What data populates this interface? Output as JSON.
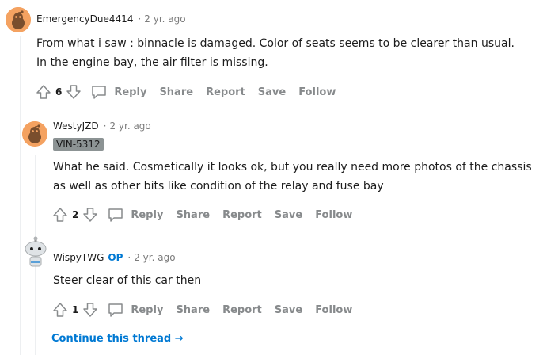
{
  "actions": {
    "reply": "Reply",
    "share": "Share",
    "report": "Report",
    "save": "Save",
    "follow": "Follow"
  },
  "comments": [
    {
      "username": "EmergencyDue4414",
      "separator": "·",
      "time": "2 yr. ago",
      "text": "From what i saw : binnacle is damaged. Color of seats seems to be clearer than usual. In the engine bay, the air filter is missing.",
      "votes": "6",
      "avatar_icon": "snoo-avatar-icon"
    },
    {
      "username": "WestyJZD",
      "separator": "·",
      "time": "2 yr. ago",
      "flair": "VIN-5312",
      "text": "What he said. Cosmetically it looks ok, but you really need more photos of the chassis as well as other bits like condition of the relay and fuse bay",
      "votes": "2",
      "avatar_icon": "snoo-avatar-icon"
    },
    {
      "username": "WispyTWG",
      "op_badge": "OP",
      "separator": "·",
      "time": "2 yr. ago",
      "text": "Steer clear of this car then",
      "votes": "1",
      "avatar_icon": "snoo-avatar-icon"
    }
  ],
  "continue_thread": "Continue this thread →",
  "colors": {
    "accent_blue": "#0079d3",
    "action_gray": "#878a8c",
    "thread_line": "#edeff1",
    "avatar_orange": "#f4a261",
    "avatar_gray": "#dfe3e6",
    "flair_bg": "#8c9394"
  }
}
